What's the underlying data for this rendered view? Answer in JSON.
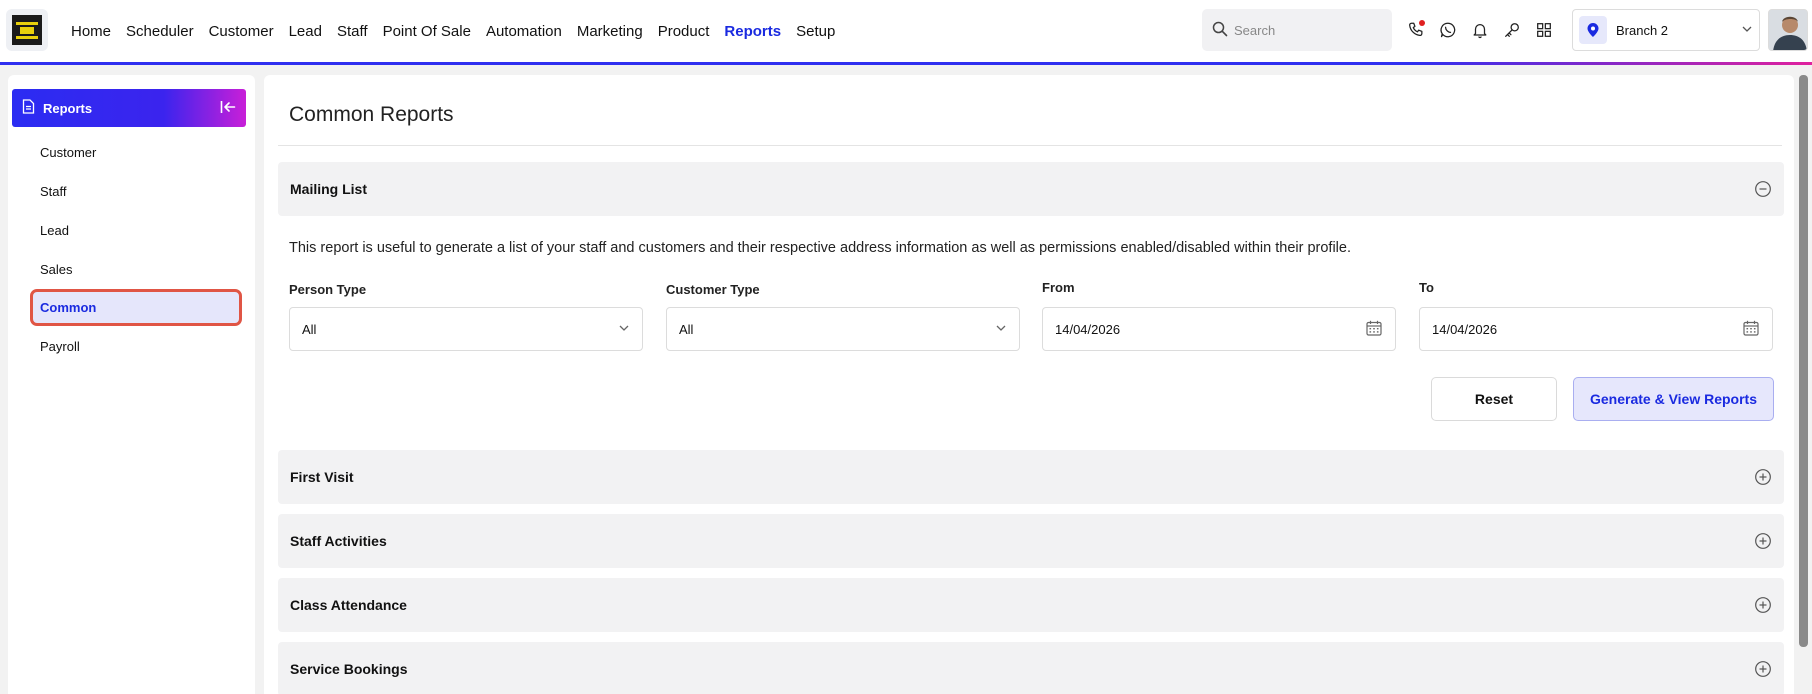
{
  "nav": {
    "items": [
      {
        "label": "Home",
        "active": false
      },
      {
        "label": "Scheduler",
        "active": false
      },
      {
        "label": "Customer",
        "active": false
      },
      {
        "label": "Lead",
        "active": false
      },
      {
        "label": "Staff",
        "active": false
      },
      {
        "label": "Point Of Sale",
        "active": false
      },
      {
        "label": "Automation",
        "active": false
      },
      {
        "label": "Marketing",
        "active": false
      },
      {
        "label": "Product",
        "active": false
      },
      {
        "label": "Reports",
        "active": true
      },
      {
        "label": "Setup",
        "active": false
      }
    ],
    "search_placeholder": "Search",
    "icons": [
      "phone-icon",
      "whatsapp-icon",
      "bell-icon",
      "key-icon",
      "apps-grid-icon"
    ],
    "branch_label": "Branch 2"
  },
  "sidebar": {
    "title": "Reports",
    "items": [
      {
        "label": "Customer",
        "active": false
      },
      {
        "label": "Staff",
        "active": false
      },
      {
        "label": "Lead",
        "active": false
      },
      {
        "label": "Sales",
        "active": false
      },
      {
        "label": "Common",
        "active": true
      },
      {
        "label": "Payroll",
        "active": false
      }
    ]
  },
  "main": {
    "title": "Common Reports",
    "mailing": {
      "title": "Mailing List",
      "expanded": true,
      "description": "This report is useful to generate a list of your staff and customers and their respective address information as well as permissions enabled/disabled within their profile.",
      "fields": {
        "person_type": {
          "label": "Person Type",
          "value": "All"
        },
        "customer_type": {
          "label": "Customer Type",
          "value": "All"
        },
        "from": {
          "label": "From",
          "value": "14/04/2026"
        },
        "to": {
          "label": "To",
          "value": "14/04/2026"
        }
      },
      "reset_label": "Reset",
      "generate_label": "Generate & View Reports"
    },
    "sections": [
      {
        "title": "First Visit",
        "expanded": false
      },
      {
        "title": "Staff Activities",
        "expanded": false
      },
      {
        "title": "Class Attendance",
        "expanded": false
      },
      {
        "title": "Service Bookings",
        "expanded": false
      }
    ]
  },
  "colors": {
    "accent": "#1a2ae0",
    "highlight_border": "#e05545",
    "header_gradient_end": "#c91fd8"
  }
}
